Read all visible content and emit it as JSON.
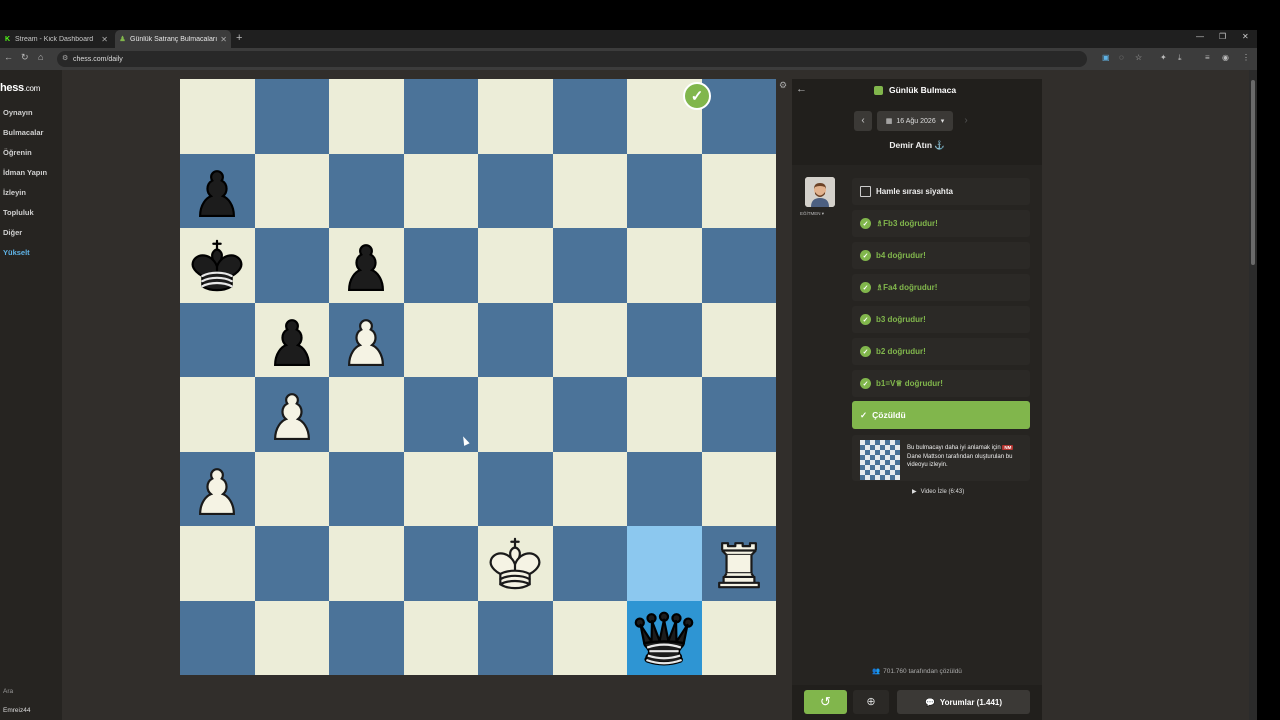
{
  "browser": {
    "tabs": [
      {
        "label": "Stream - Kick Dashboard",
        "icon": "kick-icon",
        "active": false
      },
      {
        "label": "Günlük Satranç Bulmacaları - Ch",
        "icon": "chess-pawn-icon",
        "active": true
      }
    ],
    "url": "chess.com/daily"
  },
  "sidebar": {
    "logo_main": "hess",
    "logo_suffix": ".com",
    "items": [
      "Oynayın",
      "Bulmacalar",
      "Öğrenin",
      "İdman Yapın",
      "İzleyin",
      "Topluluk",
      "Diğer",
      "Yükselt"
    ],
    "search": "Ara",
    "username": "Emreiz44"
  },
  "board": {
    "orientation": "black-at-bottom",
    "highlight": [
      "b8",
      "b7"
    ],
    "pieces": [
      {
        "square": "b8",
        "piece": "bQ"
      },
      {
        "square": "d7",
        "piece": "wK"
      },
      {
        "square": "a7",
        "piece": "wR"
      },
      {
        "square": "h6",
        "piece": "wP"
      },
      {
        "square": "g5",
        "piece": "wP"
      },
      {
        "square": "g4",
        "piece": "bP"
      },
      {
        "square": "f4",
        "piece": "wP"
      },
      {
        "square": "h3",
        "piece": "bK"
      },
      {
        "square": "f3",
        "piece": "bP"
      },
      {
        "square": "h2",
        "piece": "bP"
      }
    ]
  },
  "panel": {
    "title": "Günlük Bulmaca",
    "date": "16 Ağu 2026",
    "author": "Demir Atın",
    "coach_label": "EĞİTMEN",
    "moves": [
      {
        "text": "Hamle sırası siyahta",
        "status": "info"
      },
      {
        "text": "♗Fb3 doğrudur!",
        "status": "ok"
      },
      {
        "text": "b4 doğrudur!",
        "status": "ok"
      },
      {
        "text": "♗Fa4 doğrudur!",
        "status": "ok"
      },
      {
        "text": "b3 doğrudur!",
        "status": "ok"
      },
      {
        "text": "b2 doğrudur!",
        "status": "ok"
      },
      {
        "text": "b1=V♕ doğrudur!",
        "status": "ok"
      }
    ],
    "solved_label": "Çözüldü",
    "video_text_1": "Bu bulmacayı daha iyi anlamak için",
    "video_tag": "NM",
    "video_text_2": "Dane Mattson tarafından oluşturulan bu videoyu izleyin.",
    "video_watch": "Video İzle (6:43)",
    "solved_by": "701.760 tarafından çözüldü",
    "comments": "Yorumlar (1.441)"
  },
  "colors": {
    "light_square": "#ecedd8",
    "dark_square": "#4b7399",
    "highlight_light": "#8cc8ef",
    "highlight_dark": "#2e95d3",
    "accent_green": "#81b64c"
  }
}
